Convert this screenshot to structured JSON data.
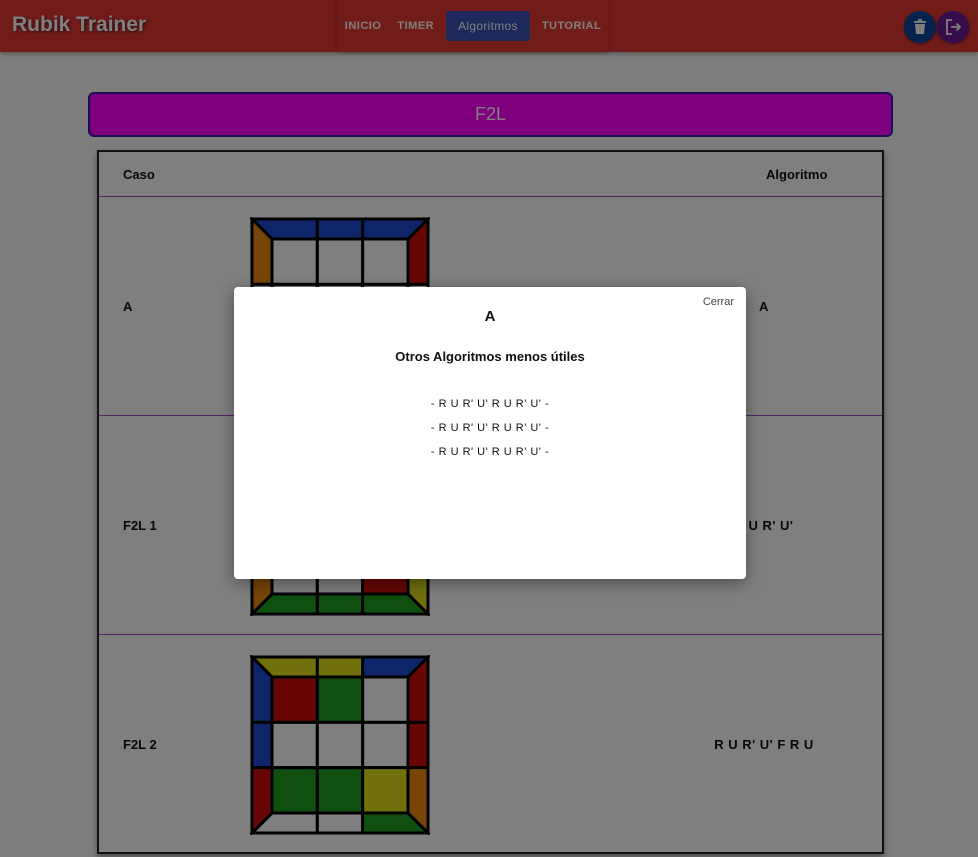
{
  "app": {
    "title": "Rubik Trainer"
  },
  "nav": {
    "items": [
      {
        "label": "INICIO"
      },
      {
        "label": "TIMER"
      },
      {
        "label": "Algoritmos"
      },
      {
        "label": "TUTORIAL"
      }
    ]
  },
  "actions": {
    "delete_icon": "trash-icon",
    "logout_icon": "logout-icon"
  },
  "section": {
    "title": "F2L"
  },
  "table": {
    "headers": {
      "case": "Caso",
      "algorithm": "Algoritmo"
    },
    "rows": [
      {
        "case": "A",
        "algorithm": "A"
      },
      {
        "case": "F2L 1",
        "algorithm": "R U R' U'"
      },
      {
        "case": "F2L 2",
        "algorithm": "R U R' U' F R U"
      }
    ]
  },
  "modal": {
    "close_label": "Cerrar",
    "title": "A",
    "subtitle": "Otros Algoritmos menos útiles",
    "algorithms": [
      "- R U R' U' R U R' U' -",
      "- R U R' U' R U R' U' -",
      "- R U R' U' R U R' U' -"
    ]
  },
  "colors": {
    "topbar": "#e53935",
    "nav_active": "#3f51b5",
    "section_title_bg": "#fc00ff",
    "cube_blue": "#1e4bd2",
    "cube_red": "#d10d0d",
    "cube_green": "#1f9e1f",
    "cube_yellow": "#e3e01a",
    "cube_orange": "#ee8a11"
  },
  "cubes": [
    {
      "top_edge": [
        "blue",
        "blue",
        "blue"
      ],
      "bottom_edge": [
        "white",
        "white",
        "white"
      ],
      "left_edge": [
        "orange",
        "white",
        "white"
      ],
      "right_edge": [
        "red",
        "white",
        "white"
      ],
      "grid": [
        "white",
        "white",
        "white",
        "white",
        "white",
        "white",
        "white",
        "white",
        "white"
      ]
    },
    {
      "top_edge": [
        "white",
        "white",
        "white"
      ],
      "bottom_edge": [
        "green",
        "green",
        "green"
      ],
      "left_edge": [
        "white",
        "white",
        "orange"
      ],
      "right_edge": [
        "white",
        "white",
        "yellow"
      ],
      "grid": [
        "white",
        "white",
        "white",
        "white",
        "white",
        "white",
        "white",
        "white",
        "red"
      ]
    },
    {
      "top_edge": [
        "yellow",
        "yellow",
        "blue"
      ],
      "bottom_edge": [
        "white",
        "white",
        "green"
      ],
      "left_edge": [
        "blue",
        "blue",
        "red"
      ],
      "right_edge": [
        "red",
        "red",
        "orange"
      ],
      "grid": [
        "red",
        "green",
        "white",
        "white",
        "white",
        "white",
        "green",
        "green",
        "yellow"
      ]
    }
  ]
}
